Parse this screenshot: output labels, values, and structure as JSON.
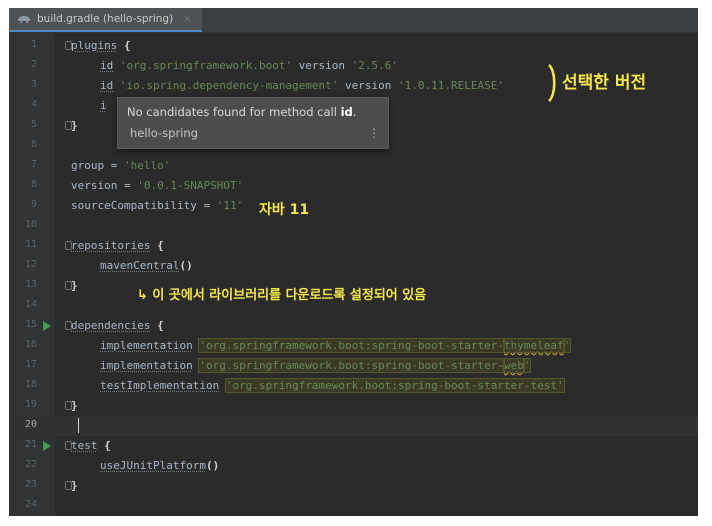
{
  "tab": {
    "icon": "gradle-elephant-icon",
    "title": "build.gradle (hello-spring)",
    "close": "×"
  },
  "lines": [
    {
      "n": "1",
      "indent": 0,
      "fold": true,
      "run": false,
      "tokens": [
        {
          "t": "plugins",
          "c": "call"
        },
        {
          "t": " {",
          "c": "bold"
        }
      ]
    },
    {
      "n": "2",
      "indent": 2,
      "fold": false,
      "run": false,
      "tokens": [
        {
          "t": "id",
          "c": "call"
        },
        {
          "t": " ",
          "c": ""
        },
        {
          "t": "'org.springframework.boot'",
          "c": "str"
        },
        {
          "t": " version ",
          "c": ""
        },
        {
          "t": "'2.5.6'",
          "c": "str"
        }
      ]
    },
    {
      "n": "3",
      "indent": 2,
      "fold": false,
      "run": false,
      "tokens": [
        {
          "t": "id",
          "c": "call"
        },
        {
          "t": " ",
          "c": ""
        },
        {
          "t": "'io.spring.dependency-management'",
          "c": "str"
        },
        {
          "t": " version ",
          "c": ""
        },
        {
          "t": "'1.0.11.RELEASE'",
          "c": "str"
        }
      ]
    },
    {
      "n": "4",
      "indent": 2,
      "fold": false,
      "run": false,
      "tokens": [
        {
          "t": "i",
          "c": "call"
        }
      ]
    },
    {
      "n": "5",
      "indent": 0,
      "fold": true,
      "run": false,
      "tokens": [
        {
          "t": "}",
          "c": "bold"
        }
      ]
    },
    {
      "n": "6",
      "indent": 0,
      "fold": false,
      "run": false,
      "tokens": []
    },
    {
      "n": "7",
      "indent": 0,
      "fold": false,
      "run": false,
      "tokens": [
        {
          "t": "group = ",
          "c": ""
        },
        {
          "t": "'hello'",
          "c": "str"
        }
      ]
    },
    {
      "n": "8",
      "indent": 0,
      "fold": false,
      "run": false,
      "tokens": [
        {
          "t": "version = ",
          "c": ""
        },
        {
          "t": "'0.0.1-SNAPSHOT'",
          "c": "str"
        }
      ]
    },
    {
      "n": "9",
      "indent": 0,
      "fold": false,
      "run": false,
      "tokens": [
        {
          "t": "sourceCompatibility = ",
          "c": ""
        },
        {
          "t": "'11'",
          "c": "str"
        }
      ]
    },
    {
      "n": "10",
      "indent": 0,
      "fold": false,
      "run": false,
      "tokens": []
    },
    {
      "n": "11",
      "indent": 0,
      "fold": true,
      "run": false,
      "tokens": [
        {
          "t": "repositories",
          "c": "call"
        },
        {
          "t": " {",
          "c": "bold"
        }
      ]
    },
    {
      "n": "12",
      "indent": 2,
      "fold": false,
      "run": false,
      "tokens": [
        {
          "t": "mavenCentral",
          "c": "call"
        },
        {
          "t": "()",
          "c": "bold"
        }
      ]
    },
    {
      "n": "13",
      "indent": 0,
      "fold": true,
      "run": false,
      "tokens": [
        {
          "t": "}",
          "c": "bold"
        }
      ]
    },
    {
      "n": "14",
      "indent": 0,
      "fold": false,
      "run": false,
      "tokens": []
    },
    {
      "n": "15",
      "indent": 0,
      "fold": true,
      "run": true,
      "tokens": [
        {
          "t": "dependencies",
          "c": "call"
        },
        {
          "t": " {",
          "c": "bold"
        }
      ]
    },
    {
      "n": "16",
      "indent": 2,
      "fold": false,
      "run": false,
      "tokens": [
        {
          "t": "implementation",
          "c": "call"
        },
        {
          "t": " ",
          "c": ""
        },
        {
          "t": "'org.springframework.boot:spring-boot-starter-",
          "c": "str hl"
        },
        {
          "t": "thymeleaf",
          "c": "str hl squig"
        },
        {
          "t": "'",
          "c": "str hl"
        }
      ]
    },
    {
      "n": "17",
      "indent": 2,
      "fold": false,
      "run": false,
      "tokens": [
        {
          "t": "implementation",
          "c": "call"
        },
        {
          "t": " ",
          "c": ""
        },
        {
          "t": "'org.springframework.boot:spring-boot-starter-",
          "c": "str hl"
        },
        {
          "t": "web",
          "c": "str hl squig"
        },
        {
          "t": "'",
          "c": "str hl"
        }
      ]
    },
    {
      "n": "18",
      "indent": 2,
      "fold": false,
      "run": false,
      "tokens": [
        {
          "t": "testImplementation",
          "c": "call"
        },
        {
          "t": " ",
          "c": ""
        },
        {
          "t": "'org.springframework.boot:spring-boot-starter-test'",
          "c": "str hl"
        }
      ]
    },
    {
      "n": "19",
      "indent": 0,
      "fold": true,
      "run": false,
      "tokens": [
        {
          "t": "}",
          "c": "bold"
        }
      ]
    },
    {
      "n": "20",
      "indent": 0,
      "fold": false,
      "run": false,
      "current": true,
      "tokens": []
    },
    {
      "n": "21",
      "indent": 0,
      "fold": true,
      "run": true,
      "tokens": [
        {
          "t": "test",
          "c": "call"
        },
        {
          "t": " {",
          "c": "bold"
        }
      ]
    },
    {
      "n": "22",
      "indent": 2,
      "fold": false,
      "run": false,
      "tokens": [
        {
          "t": "useJUnitPlatform",
          "c": "call"
        },
        {
          "t": "()",
          "c": "bold"
        }
      ]
    },
    {
      "n": "23",
      "indent": 0,
      "fold": true,
      "run": false,
      "tokens": [
        {
          "t": "}",
          "c": "bold"
        }
      ]
    },
    {
      "n": "24",
      "indent": 0,
      "fold": false,
      "run": false,
      "tokens": []
    }
  ],
  "popup": {
    "message_prefix": "No candidates found for method call ",
    "message_bold": "id",
    "message_suffix": ".",
    "context": "hello-spring",
    "more_icon": "⋮"
  },
  "annotations": {
    "selected_version": "선택한 버전",
    "java_version": "자바 11",
    "download_note": "↳ 이 곳에서 라이브러리를 다운로드록 설정되어 있음"
  },
  "colors": {
    "accent_annotation": "#f5e64b",
    "string": "#6a8759",
    "run_icon": "#499c54"
  }
}
